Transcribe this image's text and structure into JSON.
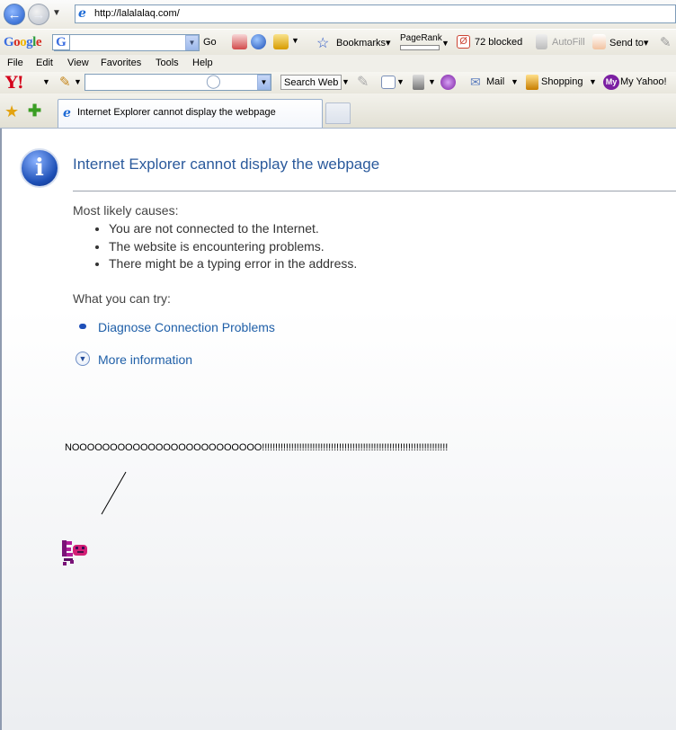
{
  "address_bar": {
    "url": "http://lalalalaq.com/"
  },
  "google_toolbar": {
    "logo": "Google",
    "go_label": "Go",
    "bookmarks_label": "Bookmarks",
    "pagerank_label": "PageRank",
    "popups_blocked_label": "72 blocked",
    "autofill_label": "AutoFill",
    "sendto_label": "Send to"
  },
  "menu": [
    "File",
    "Edit",
    "View",
    "Favorites",
    "Tools",
    "Help"
  ],
  "yahoo_toolbar": {
    "logo": "Y!",
    "search_button_label": "Search Web",
    "mail_label": "Mail",
    "shopping_label": "Shopping",
    "my_yahoo_label": "My Yahoo!",
    "my_badge": "My"
  },
  "tab": {
    "title": "Internet Explorer cannot display the webpage"
  },
  "error_page": {
    "title": "Internet Explorer cannot display the webpage",
    "causes_heading": "Most likely causes:",
    "causes": [
      "You are not connected to the Internet.",
      "The website is encountering problems.",
      "There might be a typing error in the address."
    ],
    "try_heading": "What you can try:",
    "diagnose_link": "Diagnose Connection Problems",
    "more_info_link": "More information"
  },
  "drawing": {
    "shout_text": "NOOOOOOOOOOOOOOOOOOOOOOOOO!!!!!!!!!!!!!!!!!!!!!!!!!!!!!!!!!!!!!!!!!!!!!!!!!!!!!!!!!!!!!!!!!!!!!!"
  },
  "colors": {
    "title_blue": "#2b5a9c",
    "link_blue": "#1f5fa8",
    "yahoo_red": "#d4001a"
  }
}
